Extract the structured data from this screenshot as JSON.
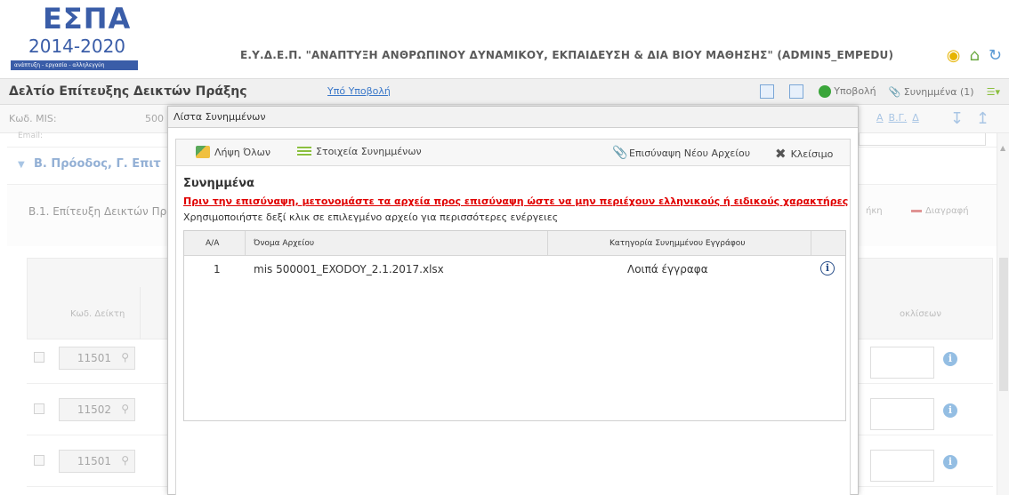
{
  "header": {
    "logo_text": "ΕΣΠΑ",
    "logo_years": "2014-2020",
    "logo_sub": "ανάπτυξη - εργασία - αλληλεγγύη",
    "title": "Ε.Υ.Δ.Ε.Π. \"ΑΝΑΠΤΥΞΗ ΑΝΘΡΩΠΙΝΟΥ ΔΥΝΑΜΙΚΟΥ, ΕΚΠΑΙΔΕΥΣΗ & ΔΙΑ ΒΙΟΥ ΜΑΘΗΣΗΣ\" (ADMIN5_EMPEDU)"
  },
  "toolbar": {
    "page_title": "Δελτίο Επίτευξης Δεικτών Πράξης",
    "status": "Υπό Υποβολή",
    "submit_label": "Υποβολή",
    "attachments_label": "Συνημμένα (1)"
  },
  "form": {
    "mis_label": "Κωδ. MIS:",
    "mis_value": "500",
    "email_label": "Email:",
    "nav_links": [
      "Α",
      "Β.Γ.",
      "Δ"
    ],
    "section_title": "Β. Πρόοδος, Γ. Επιτ",
    "subsection_title": "Β.1. Επίτευξη Δεικτών Πρ",
    "sub_action_1": "ήκη",
    "sub_action_2": "Διαγραφή",
    "col_code": "Κωδ. Δείκτη",
    "col_right": "οκλίσεων",
    "rows": [
      {
        "code": "11501"
      },
      {
        "code": "11502"
      },
      {
        "code": "11501"
      }
    ]
  },
  "modal": {
    "title": "Λίστα Συνημμένων",
    "toolbar": {
      "download_all": "Λήψη Όλων",
      "attachment_details": "Στοιχεία Συνημμένων",
      "attach_new": "Επισύναψη Νέου Αρχείου",
      "close": "Κλείσιμο"
    },
    "section_title": "Συνημμένα",
    "warning": "Πριν την επισύναψη, μετονομάστε τα αρχεία προς επισύναψη ώστε να μην περιέχουν ελληνικούς ή ειδικούς χαρακτήρες",
    "note": "Χρησιμοποιήστε δεξί κλικ σε επιλεγμένο αρχείο για περισσότερες ενέργειες",
    "table": {
      "headers": [
        "Α/Α",
        "Όνομα Αρχείου",
        "Κατηγορία Συνημμένου Εγγράφου"
      ],
      "rows": [
        {
          "index": "1",
          "filename": "mis 500001_EXODOY_2.1.2017.xlsx",
          "category": "Λοιπά έγγραφα"
        }
      ]
    }
  },
  "colors": {
    "accent_blue": "#3a5da8",
    "link_blue": "#3a78c9",
    "warning_red": "#e00000"
  }
}
